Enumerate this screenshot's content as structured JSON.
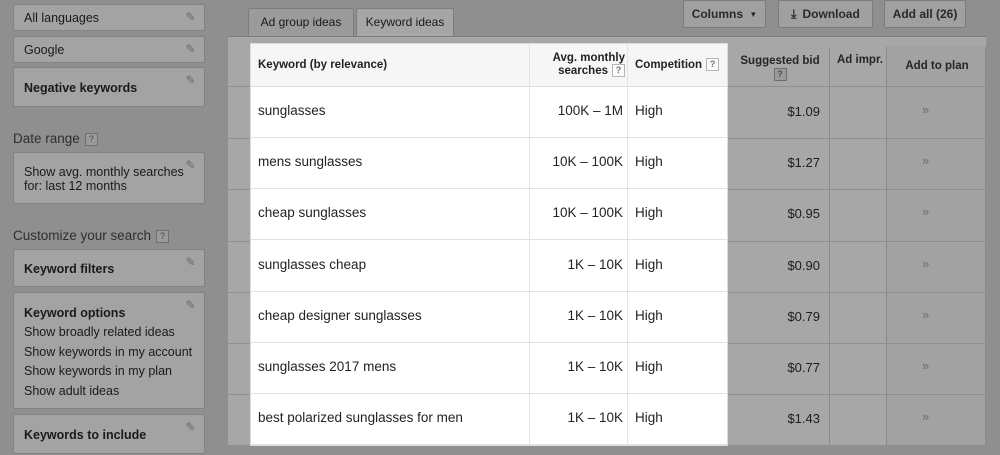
{
  "sidebar": {
    "language": "All languages",
    "network": "Google",
    "negative_keywords": "Negative keywords",
    "date_range_label": "Date range",
    "date_range_value_line1": "Show avg. monthly searches",
    "date_range_value_line2": "for: last 12 months",
    "customize_label": "Customize your search",
    "keyword_filters": "Keyword filters",
    "keyword_options": "Keyword options",
    "options": [
      "Show broadly related ideas",
      "Show keywords in my account",
      "Show keywords in my plan",
      "Show adult ideas"
    ],
    "keywords_to_include": "Keywords to include"
  },
  "tabs": {
    "ad_group_ideas": "Ad group ideas",
    "keyword_ideas": "Keyword ideas"
  },
  "toolbar": {
    "columns": "Columns",
    "download": "Download",
    "add_all": "Add all (26)"
  },
  "table": {
    "headers": {
      "keyword": "Keyword (by relevance)",
      "searches_line1": "Avg. monthly",
      "searches_line2": "searches",
      "competition": "Competition",
      "suggested_bid": "Suggested bid",
      "ad_impr": "Ad impr.",
      "add_to_plan": "Add to plan"
    },
    "help_mark": "?",
    "add_arrow": "»",
    "rows": [
      {
        "keyword": "sunglasses",
        "searches": "100K – 1M",
        "competition": "High",
        "bid": "$1.09"
      },
      {
        "keyword": "mens sunglasses",
        "searches": "10K – 100K",
        "competition": "High",
        "bid": "$1.27"
      },
      {
        "keyword": "cheap sunglasses",
        "searches": "10K – 100K",
        "competition": "High",
        "bid": "$0.95"
      },
      {
        "keyword": "sunglasses cheap",
        "searches": "1K – 10K",
        "competition": "High",
        "bid": "$0.90"
      },
      {
        "keyword": "cheap designer sunglasses",
        "searches": "1K – 10K",
        "competition": "High",
        "bid": "$0.79"
      },
      {
        "keyword": "sunglasses 2017 mens",
        "searches": "1K – 10K",
        "competition": "High",
        "bid": "$0.77"
      },
      {
        "keyword": "best polarized sunglasses for men",
        "searches": "1K – 10K",
        "competition": "High",
        "bid": "$1.43"
      }
    ]
  }
}
